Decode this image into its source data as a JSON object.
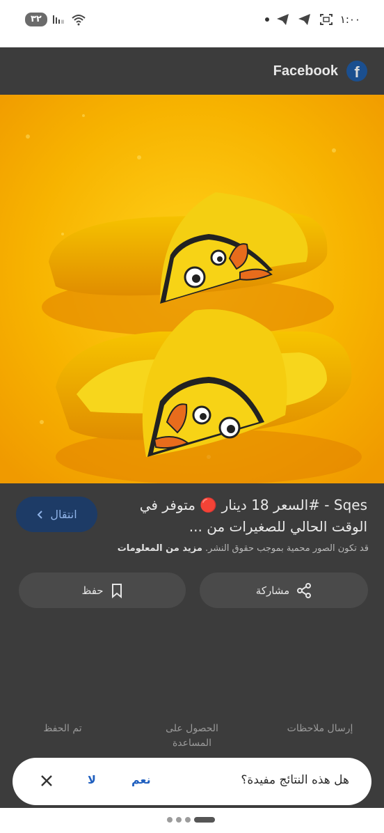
{
  "status_bar": {
    "time": "١:٠٠",
    "battery": "٣٢"
  },
  "source": {
    "name": "Facebook",
    "logo_letter": "f"
  },
  "image": {
    "description_icon": "yellow-duck-slippers-photo"
  },
  "caption": {
    "title": "Sqes - #السعر 18 دينار 🔴 متوفر في الوقت الحالي للصغيرات من ..."
  },
  "visit_button": {
    "label": "انتقال"
  },
  "copyright": {
    "text": "قد تكون الصور محمية بموجب حقوق النشر.",
    "more_link": "مزيد من المعلومات"
  },
  "actions": {
    "share_label": "مشاركة",
    "save_label": "حفظ"
  },
  "feedback": {
    "send_feedback": "إرسال ملاحظات",
    "get_help": "الحصول على المساعدة",
    "saved": "تم الحفظ"
  },
  "prompt": {
    "question": "هل هذه النتائج مفيدة؟",
    "yes": "نعم",
    "no": "لا"
  },
  "colors": {
    "overlay": "#3c3c3c",
    "accent_blue": "#1f5fbf",
    "photo_yellow": "#f6b800"
  }
}
